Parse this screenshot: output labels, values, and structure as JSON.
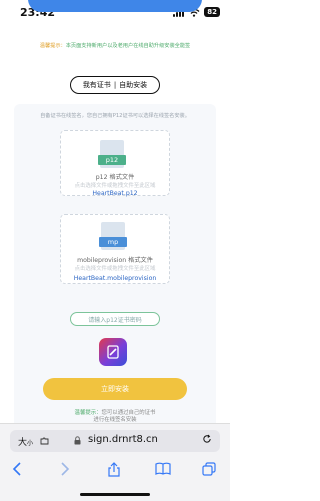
{
  "status": {
    "time": "23:42",
    "battery": "82"
  },
  "notice": {
    "prefix": "温馨提示：",
    "text": "本页面支持新用户以及老用户在线自助升级安装全能签"
  },
  "tabs": {
    "left": "我有证书",
    "sep": "|",
    "right": "自助安装"
  },
  "panel": {
    "description": "自备证书在线签名，您自己拥有P12证书可以选择在线签名安装。"
  },
  "p12_card": {
    "tag": "p12",
    "format": "p12 格式文件",
    "hint": "点击选择文件或拖拽文件至此区域",
    "filename": "HeartBeat.p12"
  },
  "mp_card": {
    "tag": "mp",
    "format": "mobileprovision 格式文件",
    "hint": "点击选择文件或拖拽文件至此区域",
    "filename": "HeartBeat.mobileprovision"
  },
  "password": {
    "placeholder": "请输入p12证书密码"
  },
  "install_button": {
    "label": "立即安装"
  },
  "bottom_note": {
    "prefix": "温馨提示：",
    "line1": "您可以通过自己的证书",
    "line2": "进行在线签名安装"
  },
  "safari": {
    "aa_big": "大",
    "aa_small": "小",
    "url": "sign.drnrt8.cn"
  },
  "icons": {
    "puzzle": "puzzle-icon",
    "lock": "lock-icon",
    "reload": "reload-icon",
    "back": "chevron-left-icon",
    "forward": "chevron-right-icon",
    "share": "share-icon",
    "bookmarks": "book-icon",
    "tabs": "tabs-icon"
  },
  "colors": {
    "primary": "#3f86e8",
    "install": "#f1c33f",
    "green": "#4caa6a",
    "link": "#2c66c4"
  }
}
